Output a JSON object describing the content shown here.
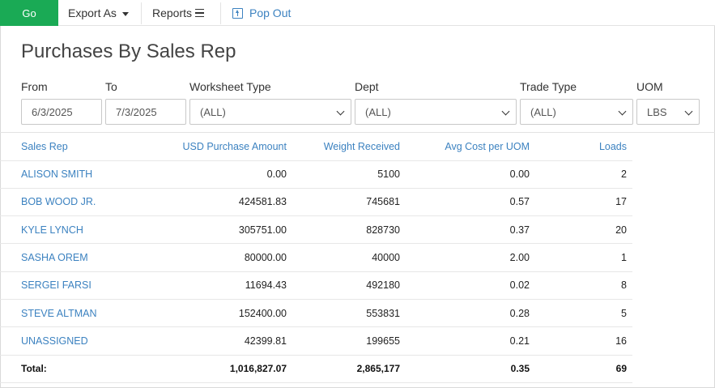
{
  "toolbar": {
    "go_label": "Go",
    "export_label": "Export As",
    "reports_label": "Reports",
    "popout_label": "Pop Out"
  },
  "page": {
    "title": "Purchases By Sales Rep"
  },
  "filters": {
    "from": {
      "label": "From",
      "value": "6/3/2025"
    },
    "to": {
      "label": "To",
      "value": "7/3/2025"
    },
    "worksheet_type": {
      "label": "Worksheet Type",
      "value": "(ALL)"
    },
    "dept": {
      "label": "Dept",
      "value": "(ALL)"
    },
    "trade_type": {
      "label": "Trade Type",
      "value": "(ALL)"
    },
    "uom": {
      "label": "UOM",
      "value": "LBS"
    }
  },
  "table": {
    "headers": [
      "Sales Rep",
      "USD Purchase Amount",
      "Weight Received",
      "Avg Cost per UOM",
      "Loads"
    ],
    "rows": [
      [
        "ALISON SMITH",
        "0.00",
        "5100",
        "0.00",
        "2"
      ],
      [
        "BOB WOOD JR.",
        "424581.83",
        "745681",
        "0.57",
        "17"
      ],
      [
        "KYLE LYNCH",
        "305751.00",
        "828730",
        "0.37",
        "20"
      ],
      [
        "SASHA OREM",
        "80000.00",
        "40000",
        "2.00",
        "1"
      ],
      [
        "SERGEI FARSI",
        "11694.43",
        "492180",
        "0.02",
        "8"
      ],
      [
        "STEVE ALTMAN",
        "152400.00",
        "553831",
        "0.28",
        "5"
      ],
      [
        "UNASSIGNED",
        "42399.81",
        "199655",
        "0.21",
        "16"
      ]
    ],
    "total": [
      "Total:",
      "1,016,827.07",
      "2,865,177",
      "0.35",
      "69"
    ]
  },
  "colors": {
    "go": "#1aaa55",
    "link": "#3c82c0"
  }
}
